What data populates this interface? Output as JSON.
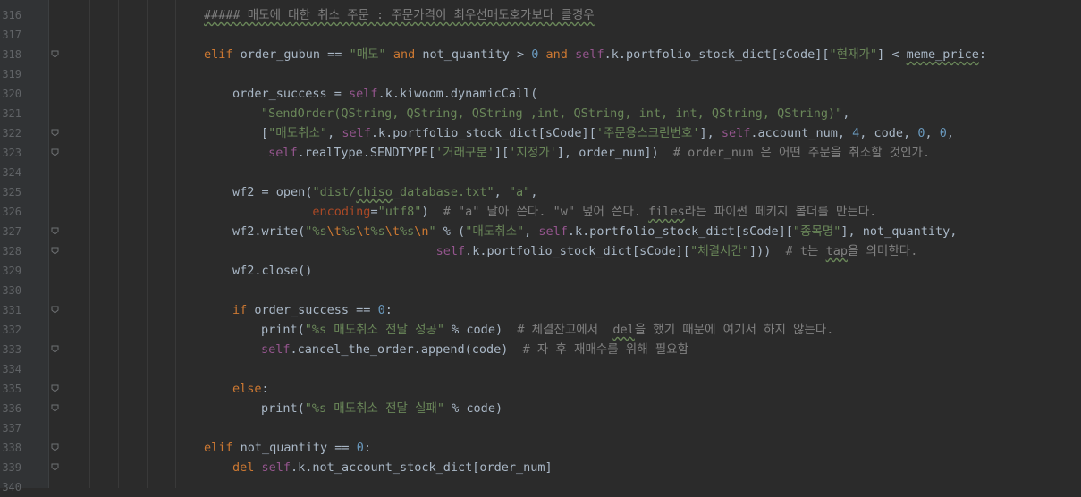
{
  "editor": {
    "lines": [
      {
        "n": "316",
        "indent": 0,
        "fold": false,
        "tokens": [
          {
            "t": "##### 매도에 대한 취소 주문 : 주문가격이 최우선매도호가보다 클경우",
            "c": "cmt typo"
          }
        ]
      },
      {
        "n": "317",
        "indent": 0,
        "fold": false,
        "tokens": []
      },
      {
        "n": "318",
        "indent": 0,
        "fold": true,
        "tokens": [
          {
            "t": "elif",
            "c": "kw"
          },
          {
            "t": " order_gubun == ",
            "c": ""
          },
          {
            "t": "\"매도\"",
            "c": "str"
          },
          {
            "t": " ",
            "c": ""
          },
          {
            "t": "and",
            "c": "kw"
          },
          {
            "t": " not_quantity > ",
            "c": ""
          },
          {
            "t": "0",
            "c": "num"
          },
          {
            "t": " ",
            "c": ""
          },
          {
            "t": "and",
            "c": "kw"
          },
          {
            "t": " ",
            "c": ""
          },
          {
            "t": "self",
            "c": "self"
          },
          {
            "t": ".k.portfolio_stock_dict[sCode][",
            "c": ""
          },
          {
            "t": "\"현재가\"",
            "c": "str"
          },
          {
            "t": "] < ",
            "c": ""
          },
          {
            "t": "meme_price",
            "c": "typo"
          },
          {
            "t": ":",
            "c": ""
          }
        ]
      },
      {
        "n": "319",
        "indent": 0,
        "fold": false,
        "tokens": []
      },
      {
        "n": "320",
        "indent": 1,
        "fold": false,
        "tokens": [
          {
            "t": "order_success = ",
            "c": ""
          },
          {
            "t": "self",
            "c": "self"
          },
          {
            "t": ".k.kiwoom.dynamicCall(",
            "c": ""
          }
        ]
      },
      {
        "n": "321",
        "indent": 2,
        "fold": false,
        "tokens": [
          {
            "t": "\"SendOrder(QString, QString, QString ,int, QString, int, int, QString, QString)\"",
            "c": "str"
          },
          {
            "t": ",",
            "c": ""
          }
        ]
      },
      {
        "n": "322",
        "indent": 2,
        "fold": true,
        "tokens": [
          {
            "t": "[",
            "c": ""
          },
          {
            "t": "\"매도취소\"",
            "c": "str"
          },
          {
            "t": ", ",
            "c": ""
          },
          {
            "t": "self",
            "c": "self"
          },
          {
            "t": ".k.portfolio_stock_dict[sCode][",
            "c": ""
          },
          {
            "t": "'주문용스크린번호'",
            "c": "str"
          },
          {
            "t": "], ",
            "c": ""
          },
          {
            "t": "self",
            "c": "self"
          },
          {
            "t": ".account_num, ",
            "c": ""
          },
          {
            "t": "4",
            "c": "num"
          },
          {
            "t": ", code, ",
            "c": ""
          },
          {
            "t": "0",
            "c": "num"
          },
          {
            "t": ", ",
            "c": ""
          },
          {
            "t": "0",
            "c": "num"
          },
          {
            "t": ",",
            "c": ""
          }
        ]
      },
      {
        "n": "323",
        "indent": 2,
        "fold": true,
        "pre": " ",
        "tokens": [
          {
            "t": "self",
            "c": "self"
          },
          {
            "t": ".realType.SENDTYPE[",
            "c": ""
          },
          {
            "t": "'거래구분'",
            "c": "str"
          },
          {
            "t": "][",
            "c": ""
          },
          {
            "t": "'지정가'",
            "c": "str"
          },
          {
            "t": "], order_num])  ",
            "c": ""
          },
          {
            "t": "# order_num 은 어떤 주문을 취소할 것인가.",
            "c": "cmt"
          }
        ]
      },
      {
        "n": "324",
        "indent": 0,
        "fold": false,
        "tokens": []
      },
      {
        "n": "325",
        "indent": 1,
        "fold": false,
        "tokens": [
          {
            "t": "wf2 = ",
            "c": ""
          },
          {
            "t": "open",
            "c": ""
          },
          {
            "t": "(",
            "c": ""
          },
          {
            "t": "\"dist/",
            "c": "str"
          },
          {
            "t": "chiso",
            "c": "str typo"
          },
          {
            "t": "_database.txt\"",
            "c": "str"
          },
          {
            "t": ", ",
            "c": ""
          },
          {
            "t": "\"a\"",
            "c": "str"
          },
          {
            "t": ",",
            "c": ""
          }
        ]
      },
      {
        "n": "326",
        "indent": 1,
        "fold": false,
        "pre": "           ",
        "tokens": [
          {
            "t": "encoding",
            "c": "kwarg"
          },
          {
            "t": "=",
            "c": ""
          },
          {
            "t": "\"utf8\"",
            "c": "str"
          },
          {
            "t": ")  ",
            "c": ""
          },
          {
            "t": "# \"a\" 달아 쓴다. \"w\" 덮어 쓴다. ",
            "c": "cmt"
          },
          {
            "t": "files",
            "c": "cmt typo"
          },
          {
            "t": "라는 파이썬 페키지 볼더를 만든다.",
            "c": "cmt"
          }
        ]
      },
      {
        "n": "327",
        "indent": 1,
        "fold": true,
        "tokens": [
          {
            "t": "wf2.write(",
            "c": ""
          },
          {
            "t": "\"%s",
            "c": "str"
          },
          {
            "t": "\\t",
            "c": "esc"
          },
          {
            "t": "%s",
            "c": "str"
          },
          {
            "t": "\\t",
            "c": "esc"
          },
          {
            "t": "%s",
            "c": "str"
          },
          {
            "t": "\\t",
            "c": "esc"
          },
          {
            "t": "%s",
            "c": "str"
          },
          {
            "t": "\\n",
            "c": "esc"
          },
          {
            "t": "\"",
            "c": "str"
          },
          {
            "t": " % (",
            "c": ""
          },
          {
            "t": "\"매도취소\"",
            "c": "str"
          },
          {
            "t": ", ",
            "c": ""
          },
          {
            "t": "self",
            "c": "self"
          },
          {
            "t": ".k.portfolio_stock_dict[sCode][",
            "c": ""
          },
          {
            "t": "\"종목명\"",
            "c": "str"
          },
          {
            "t": "], not_quantity,",
            "c": ""
          }
        ]
      },
      {
        "n": "328",
        "indent": 1,
        "fold": true,
        "pre": "                            ",
        "tokens": [
          {
            "t": "self",
            "c": "self"
          },
          {
            "t": ".k.portfolio_stock_dict[sCode][",
            "c": ""
          },
          {
            "t": "\"체결시간\"",
            "c": "str"
          },
          {
            "t": "]))  ",
            "c": ""
          },
          {
            "t": "# t는 ",
            "c": "cmt"
          },
          {
            "t": "tap",
            "c": "cmt typo"
          },
          {
            "t": "을 의미한다.",
            "c": "cmt"
          }
        ]
      },
      {
        "n": "329",
        "indent": 1,
        "fold": false,
        "tokens": [
          {
            "t": "wf2.close()",
            "c": ""
          }
        ]
      },
      {
        "n": "330",
        "indent": 0,
        "fold": false,
        "tokens": []
      },
      {
        "n": "331",
        "indent": 1,
        "fold": true,
        "tokens": [
          {
            "t": "if",
            "c": "kw"
          },
          {
            "t": " order_success == ",
            "c": ""
          },
          {
            "t": "0",
            "c": "num"
          },
          {
            "t": ":",
            "c": ""
          }
        ]
      },
      {
        "n": "332",
        "indent": 2,
        "fold": false,
        "tokens": [
          {
            "t": "print",
            "c": ""
          },
          {
            "t": "(",
            "c": ""
          },
          {
            "t": "\"%s 매도취소 전달 성공\"",
            "c": "str"
          },
          {
            "t": " % code)  ",
            "c": ""
          },
          {
            "t": "# 체결잔고에서  ",
            "c": "cmt"
          },
          {
            "t": "del",
            "c": "cmt typo"
          },
          {
            "t": "을 했기 때문에 여기서 하지 않는다.",
            "c": "cmt"
          }
        ]
      },
      {
        "n": "333",
        "indent": 2,
        "fold": true,
        "tokens": [
          {
            "t": "self",
            "c": "self"
          },
          {
            "t": ".cancel_the_order.append(code)  ",
            "c": ""
          },
          {
            "t": "# 자 후 재매수를 위해 필요함",
            "c": "cmt"
          }
        ]
      },
      {
        "n": "334",
        "indent": 0,
        "fold": false,
        "tokens": []
      },
      {
        "n": "335",
        "indent": 1,
        "fold": true,
        "tokens": [
          {
            "t": "else",
            "c": "kw"
          },
          {
            "t": ":",
            "c": ""
          }
        ]
      },
      {
        "n": "336",
        "indent": 2,
        "fold": true,
        "tokens": [
          {
            "t": "print",
            "c": ""
          },
          {
            "t": "(",
            "c": ""
          },
          {
            "t": "\"%s 매도취소 전달 실패\"",
            "c": "str"
          },
          {
            "t": " % code)",
            "c": ""
          }
        ]
      },
      {
        "n": "337",
        "indent": 0,
        "fold": false,
        "tokens": []
      },
      {
        "n": "338",
        "indent": 0,
        "fold": true,
        "tokens": [
          {
            "t": "elif",
            "c": "kw"
          },
          {
            "t": " not_quantity == ",
            "c": ""
          },
          {
            "t": "0",
            "c": "num"
          },
          {
            "t": ":",
            "c": ""
          }
        ]
      },
      {
        "n": "339",
        "indent": 1,
        "fold": true,
        "tokens": [
          {
            "t": "del",
            "c": "kw"
          },
          {
            "t": " ",
            "c": ""
          },
          {
            "t": "self",
            "c": "self"
          },
          {
            "t": ".k.not_account_stock_dict[order_num]",
            "c": ""
          }
        ]
      },
      {
        "n": "340",
        "indent": 0,
        "fold": false,
        "tokens": []
      }
    ]
  }
}
